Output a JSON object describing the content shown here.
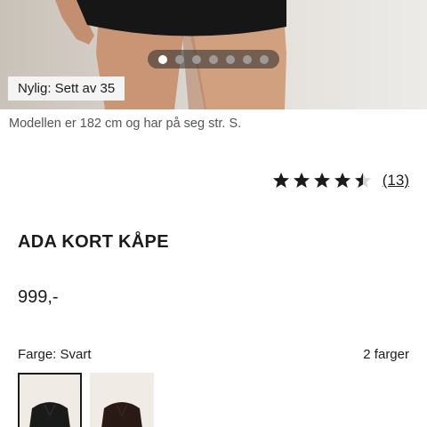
{
  "gallery": {
    "dot_count": 7,
    "active_index": 0
  },
  "badge": {
    "label": "Nylig: Sett av 35"
  },
  "model_note": "Modellen er 182 cm og har på seg str. S.",
  "rating": {
    "value": 4.5,
    "max": 5,
    "review_count_label": "(13)"
  },
  "product": {
    "title": "ADA KORT KÅPE",
    "price": "999,-"
  },
  "colors": {
    "label": "Farge: Svart",
    "count_label": "2 farger",
    "swatches": [
      {
        "name": "Svart",
        "hex": "#1a1a1a",
        "selected": true
      },
      {
        "name": "Mørk brun",
        "hex": "#2a1a16",
        "selected": false
      }
    ]
  }
}
